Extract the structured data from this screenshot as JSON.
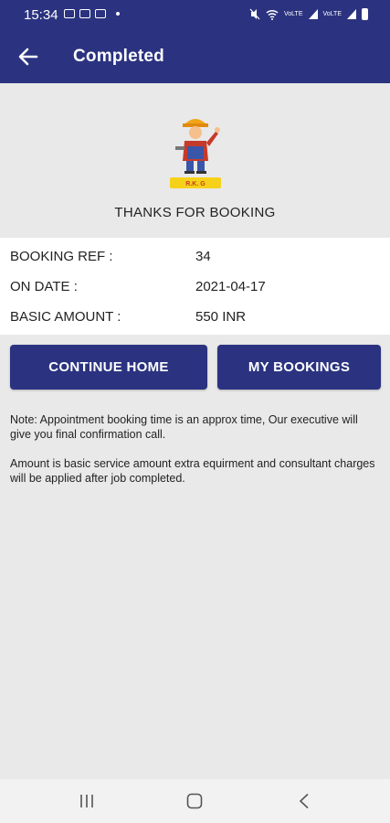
{
  "status_bar": {
    "time": "15:34",
    "network_label_1": "VoLTE",
    "network_label_2": "VoLTE"
  },
  "app_bar": {
    "title": "Completed"
  },
  "logo": {
    "text": "R.K. G"
  },
  "thanks_text": "THANKS FOR BOOKING",
  "details": [
    {
      "label": "BOOKING REF :",
      "value": "34"
    },
    {
      "label": "ON DATE :",
      "value": "2021-04-17"
    },
    {
      "label": "BASIC AMOUNT :",
      "value": "550 INR"
    }
  ],
  "buttons": {
    "continue_home": "CONTINUE HOME",
    "my_bookings": "MY BOOKINGS"
  },
  "notes": {
    "note1": "Note: Appointment booking time is an approx time, Our executive will give you final confirmation call.",
    "note2": "Amount is basic service amount extra equirment and consultant charges will be applied after job completed."
  },
  "colors": {
    "primary": "#2b3380",
    "background": "#e9e9e9",
    "card": "#ffffff"
  }
}
